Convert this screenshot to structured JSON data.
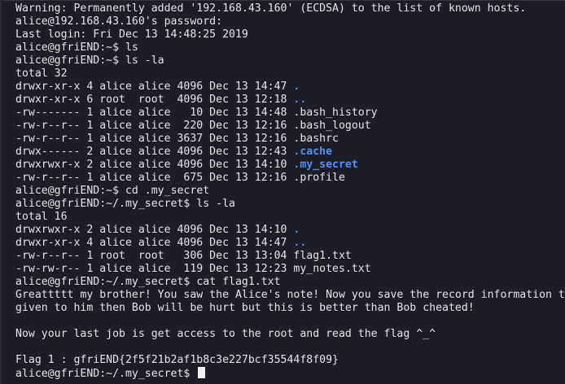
{
  "terminal": {
    "prompt_home": "alice@gfriEND:~$",
    "prompt_secret": "alice@gfriEND:~/.my_secret$",
    "lines": {
      "l0": "Warning: Permanently added '192.168.43.160' (ECDSA) to the list of known hosts.",
      "l1": "alice@192.168.43.160's password:",
      "l2": "Last login: Fri Dec 13 14:48:25 2019",
      "l3_cmd": " ls",
      "l4_cmd": " ls -la",
      "l5": "total 32",
      "ls1": [
        {
          "meta": "drwxr-xr-x 4 alice alice 4096 Dec 13 14:47 ",
          "name": "."
        },
        {
          "meta": "drwxr-xr-x 6 root  root  4096 Dec 13 12:18 ",
          "name": ".."
        },
        {
          "meta": "-rw------- 1 alice alice   10 Dec 13 14:48 ",
          "name": ".bash_history"
        },
        {
          "meta": "-rw-r--r-- 1 alice alice  220 Dec 13 12:16 ",
          "name": ".bash_logout"
        },
        {
          "meta": "-rw-r--r-- 1 alice alice 3637 Dec 13 12:16 ",
          "name": ".bashrc"
        },
        {
          "meta": "drwx------ 2 alice alice 4096 Dec 13 12:43 ",
          "name": ".cache"
        },
        {
          "meta": "drwxrwxr-x 2 alice alice 4096 Dec 13 14:10 ",
          "name": ".my_secret"
        },
        {
          "meta": "-rw-r--r-- 1 alice alice  675 Dec 13 12:16 ",
          "name": ".profile"
        }
      ],
      "l14_cmd": " cd .my_secret",
      "l15_cmd": " ls -la",
      "l16": "total 16",
      "ls2": [
        {
          "meta": "drwxrwxr-x 2 alice alice 4096 Dec 13 14:10 ",
          "name": "."
        },
        {
          "meta": "drwxr-xr-x 4 alice alice 4096 Dec 13 14:47 ",
          "name": ".."
        },
        {
          "meta": "-rw-r--r-- 1 root  root   306 Dec 13 13:04 ",
          "name": "flag1.txt"
        },
        {
          "meta": "-rw-rw-r-- 1 alice alice  119 Dec 13 12:23 ",
          "name": "my_notes.txt"
        }
      ],
      "l21_cmd": " cat flag1.txt",
      "l22": "Greattttt my brother! You saw the Alice's note! Now you save the record information t",
      "l23": "given to him then Bob will be hurt but this is better than Bob cheated!",
      "l25": "Now your last job is get access to the root and read the flag ^_^",
      "l27": "Flag 1 : gfriEND{2f5f21b2af1b8c3e227bcf35544f8f09}",
      "l28_cmd": " "
    }
  },
  "colors": {
    "background": "#1c1d26",
    "foreground": "#e6e6e6",
    "directory": "#4f8ff7"
  }
}
